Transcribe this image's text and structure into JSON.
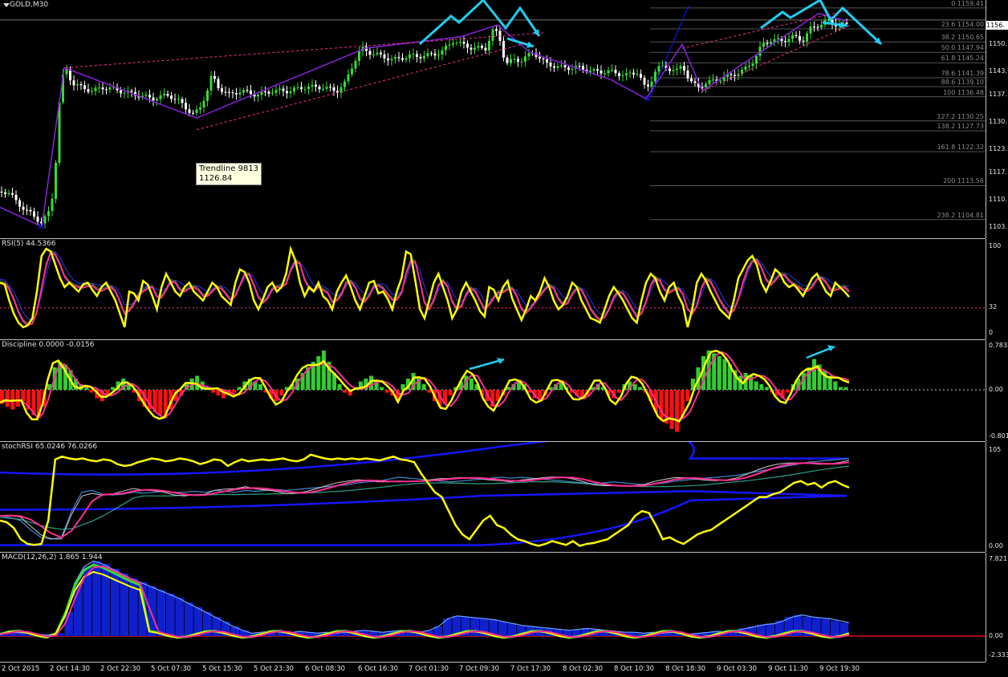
{
  "chart_data": [
    {
      "type": "candlestick",
      "title": "GOLD,M30",
      "price_ticks": [
        "1150.",
        "1143.",
        "1137.",
        "1130.",
        "1123.",
        "1117.",
        "1110.",
        "1103."
      ],
      "current_price": "1156.",
      "close_path": [
        [
          0,
          1112
        ],
        [
          10,
          1112
        ],
        [
          22,
          1109
        ],
        [
          40,
          1106
        ],
        [
          52,
          1104
        ],
        [
          62,
          1107
        ],
        [
          68,
          1114
        ],
        [
          72,
          1130
        ],
        [
          76,
          1140
        ],
        [
          82,
          1144
        ],
        [
          90,
          1140
        ],
        [
          100,
          1139
        ],
        [
          115,
          1138
        ],
        [
          130,
          1139
        ],
        [
          150,
          1138
        ],
        [
          170,
          1137
        ],
        [
          190,
          1136
        ],
        [
          210,
          1137
        ],
        [
          225,
          1135
        ],
        [
          240,
          1132
        ],
        [
          248,
          1133
        ],
        [
          258,
          1138
        ],
        [
          264,
          1142
        ],
        [
          272,
          1139
        ],
        [
          285,
          1137
        ],
        [
          300,
          1138
        ],
        [
          320,
          1137
        ],
        [
          340,
          1138
        ],
        [
          360,
          1138
        ],
        [
          380,
          1139
        ],
        [
          400,
          1139
        ],
        [
          420,
          1138
        ],
        [
          430,
          1140
        ],
        [
          440,
          1145
        ],
        [
          450,
          1149
        ],
        [
          460,
          1148
        ],
        [
          475,
          1147
        ],
        [
          490,
          1146
        ],
        [
          510,
          1147
        ],
        [
          530,
          1147
        ],
        [
          550,
          1148
        ],
        [
          565,
          1151
        ],
        [
          575,
          1150
        ],
        [
          590,
          1149
        ],
        [
          605,
          1149
        ],
        [
          615,
          1154
        ],
        [
          622,
          1152
        ],
        [
          630,
          1145
        ],
        [
          640,
          1146
        ],
        [
          650,
          1146
        ],
        [
          665,
          1148
        ],
        [
          680,
          1145
        ],
        [
          700,
          1144
        ],
        [
          720,
          1144
        ],
        [
          740,
          1143
        ],
        [
          760,
          1143
        ],
        [
          780,
          1142
        ],
        [
          795,
          1143
        ],
        [
          805,
          1138
        ],
        [
          812,
          1141
        ],
        [
          818,
          1144
        ],
        [
          830,
          1144
        ],
        [
          845,
          1143
        ],
        [
          850,
          1145
        ],
        [
          856,
          1142
        ],
        [
          862,
          1140
        ],
        [
          870,
          1139
        ],
        [
          880,
          1140
        ],
        [
          895,
          1141
        ],
        [
          910,
          1142
        ],
        [
          925,
          1143
        ],
        [
          940,
          1146
        ],
        [
          950,
          1150
        ],
        [
          960,
          1151
        ],
        [
          975,
          1151
        ],
        [
          990,
          1152
        ],
        [
          1000,
          1151
        ],
        [
          1010,
          1154
        ],
        [
          1020,
          1155
        ],
        [
          1030,
          1156
        ],
        [
          1045,
          1155
        ],
        [
          1055,
          1155
        ]
      ],
      "fibonacci": [
        {
          "level": "0",
          "price": "1159.41"
        },
        {
          "level": "23.6",
          "price": "1154.00"
        },
        {
          "level": "38.2",
          "price": "1150.65"
        },
        {
          "level": "50.0",
          "price": "1147.94"
        },
        {
          "level": "61.8",
          "price": "1145.24"
        },
        {
          "level": "78.6",
          "price": "1141.39"
        },
        {
          "level": "88.6",
          "price": "1139.10"
        },
        {
          "level": "100",
          "price": "1136.48"
        },
        {
          "level": "127.2",
          "price": "1130.25"
        },
        {
          "level": "138.2",
          "price": "1127.73"
        },
        {
          "level": "161.8",
          "price": "1122.32"
        },
        {
          "level": "200",
          "price": "1113.56"
        },
        {
          "level": "238.2",
          "price": "1104.81"
        }
      ],
      "tooltip": {
        "line1": "Trendline 9813",
        "line2": "1126.84"
      }
    },
    {
      "type": "line",
      "title": "RSI(5) 44.5366",
      "y_ticks": [
        "100",
        "32",
        "0"
      ],
      "ylim": [
        0,
        100
      ],
      "level": 32,
      "series": [
        {
          "values": [
            60,
            58,
            40,
            25,
            15,
            10,
            12,
            20,
            50,
            90,
            98,
            95,
            80,
            65,
            55,
            60,
            55,
            50,
            58,
            60,
            52,
            45,
            55,
            60,
            50,
            40,
            25,
            10,
            50,
            48,
            40,
            62,
            58,
            45,
            30,
            55,
            70,
            60,
            50,
            45,
            55,
            60,
            50,
            45,
            40,
            50,
            60,
            55,
            45,
            40,
            35,
            60,
            75,
            72,
            60,
            40,
            30,
            42,
            55,
            60,
            50,
            55,
            70,
            98,
            85,
            60,
            45,
            55,
            50,
            60,
            45,
            40,
            30,
            50,
            60,
            68,
            55,
            40,
            30,
            45,
            60,
            62,
            48,
            50,
            42,
            30,
            50,
            65,
            95,
            92,
            62,
            30,
            20,
            40,
            60,
            70,
            55,
            40,
            20,
            30,
            50,
            60,
            50,
            40,
            28,
            22,
            55,
            52,
            40,
            55,
            62,
            42,
            30,
            18,
            30,
            45,
            40,
            50,
            65,
            55,
            40,
            30,
            35,
            45,
            60,
            55,
            40,
            30,
            20,
            18,
            15,
            30,
            45,
            55,
            48,
            40,
            30,
            20,
            15,
            40,
            60,
            70,
            65,
            50,
            40,
            55,
            60,
            45,
            35,
            10,
            30,
            60,
            70,
            62,
            50,
            40,
            30,
            25,
            20,
            40,
            65,
            75,
            85,
            90,
            80,
            60,
            50,
            62,
            75,
            70,
            60,
            55,
            58,
            52,
            45,
            55,
            65,
            70,
            60,
            50,
            45,
            60,
            55,
            50,
            44
          ]
        }
      ]
    },
    {
      "type": "bar",
      "title": "Discipline 0.0000 -0.0156",
      "y_ticks": [
        "0.7832",
        "0.00",
        "-0.801"
      ],
      "ylim": [
        -0.801,
        0.7832
      ],
      "values": [
        -0.25,
        -0.3,
        -0.35,
        -0.3,
        -0.2,
        -0.35,
        -0.45,
        -0.5,
        -0.3,
        0.1,
        0.4,
        0.5,
        0.45,
        0.35,
        0.2,
        0.1,
        0.05,
        -0.05,
        -0.15,
        -0.2,
        -0.1,
        0.05,
        0.15,
        0.2,
        0.1,
        -0.05,
        -0.2,
        -0.3,
        -0.35,
        -0.4,
        -0.45,
        -0.5,
        -0.35,
        -0.2,
        -0.1,
        0.1,
        0.2,
        0.25,
        0.15,
        0.05,
        -0.05,
        -0.1,
        -0.15,
        -0.1,
        -0.05,
        0.05,
        0.15,
        0.2,
        0.15,
        0.1,
        -0.05,
        -0.15,
        -0.2,
        -0.1,
        0.05,
        0.1,
        0.2,
        0.3,
        0.4,
        0.5,
        0.6,
        0.7,
        0.5,
        0.3,
        0.1,
        -0.05,
        -0.1,
        0.05,
        0.15,
        0.2,
        0.25,
        0.15,
        0.05,
        -0.05,
        -0.1,
        -0.2,
        0.1,
        0.2,
        0.3,
        0.2,
        0.1,
        -0.05,
        -0.2,
        -0.3,
        -0.25,
        -0.1,
        0.05,
        0.15,
        0.25,
        0.2,
        0.1,
        -0.1,
        -0.2,
        -0.3,
        -0.2,
        -0.1,
        0.05,
        0.1,
        0.15,
        0.1,
        -0.05,
        -0.15,
        -0.2,
        -0.1,
        0.05,
        0.1,
        0.15,
        0.05,
        -0.05,
        -0.1,
        -0.15,
        -0.1,
        0.05,
        0.1,
        0.05,
        -0.1,
        -0.15,
        -0.05,
        0.1,
        0.15,
        0.1,
        0.05,
        -0.05,
        -0.2,
        -0.4,
        -0.55,
        -0.6,
        -0.7,
        -0.75,
        -0.5,
        -0.2,
        0.2,
        0.4,
        0.6,
        0.7,
        0.65,
        0.6,
        0.55,
        0.45,
        0.35,
        0.25,
        0.3,
        0.25,
        0.15,
        0.1,
        0.05,
        -0.05,
        -0.1,
        -0.15,
        -0.05,
        0.1,
        0.2,
        0.3,
        0.4,
        0.55,
        0.45,
        0.35,
        0.25,
        0.15,
        0.05,
        0.05
      ]
    },
    {
      "type": "line",
      "title": "stochRSI 65.0246 76.0266",
      "y_ticks": [
        "105",
        "0.00"
      ],
      "ylim": [
        0,
        105
      ],
      "series": [
        {
          "values": [
            30,
            28,
            22,
            10,
            5,
            4,
            5,
            30,
            95,
            98,
            96,
            95,
            96,
            94,
            93,
            95,
            94,
            90,
            88,
            89,
            92,
            94,
            96,
            95,
            93,
            94,
            96,
            95,
            93,
            90,
            92,
            95,
            94,
            88,
            92,
            95,
            93,
            94,
            95,
            94,
            95,
            96,
            94,
            93,
            95,
            100,
            98,
            96,
            95,
            96,
            95,
            96,
            95,
            96,
            95,
            94,
            96,
            98,
            95,
            94,
            92,
            80,
            70,
            60,
            55,
            40,
            25,
            15,
            10,
            20,
            30,
            35,
            25,
            22,
            15,
            10,
            8,
            5,
            3,
            5,
            8,
            6,
            4,
            8,
            3,
            5,
            6,
            8,
            10,
            15,
            20,
            25,
            35,
            40,
            38,
            25,
            10,
            12,
            8,
            5,
            10,
            15,
            18,
            20,
            25,
            30,
            35,
            40,
            45,
            50,
            55,
            55,
            58,
            60,
            65,
            70,
            72,
            68,
            70,
            65,
            70,
            72,
            68,
            65
          ]
        },
        {
          "values": [
            35,
            33,
            30,
            20,
            12,
            10,
            12,
            40,
            60,
            62,
            58,
            57,
            58,
            60,
            59,
            60,
            61,
            60,
            60,
            61,
            60,
            62,
            61,
            60,
            62,
            61,
            62,
            63,
            62,
            63,
            64,
            65,
            66,
            67,
            68,
            70,
            71,
            72,
            74,
            76,
            75,
            74,
            73,
            72,
            71,
            72,
            73,
            74,
            75,
            76,
            75,
            76,
            75,
            74,
            73,
            72,
            71,
            70,
            69,
            70,
            71,
            70,
            69,
            68,
            69,
            70,
            72,
            73,
            74,
            75,
            76,
            77,
            78,
            80,
            82,
            84,
            86,
            88,
            90,
            92,
            93,
            94,
            95,
            96
          ]
        }
      ]
    },
    {
      "type": "area",
      "title": "MACD(12,26,2) 1.865 1.944",
      "y_ticks": [
        "7.821",
        "0.00",
        "-2.333"
      ],
      "ylim": [
        -2.333,
        7.821
      ],
      "values": [
        0.3,
        0.4,
        0.35,
        0.3,
        0.2,
        0.1,
        0.3,
        2.5,
        5.5,
        7.2,
        7.8,
        7.5,
        7.0,
        6.5,
        6.0,
        5.6,
        5.2,
        4.8,
        4.4,
        4.0,
        3.5,
        3.0,
        2.5,
        2.0,
        1.5,
        1.0,
        0.6,
        0.3,
        0.4,
        0.5,
        0.4,
        0.3,
        0.5,
        0.4,
        0.3,
        0.4,
        0.3,
        0.4,
        0.5,
        0.6,
        0.5,
        0.4,
        0.5,
        0.6,
        0.5,
        0.4,
        0.6,
        1.0,
        1.8,
        2.1,
        2.0,
        1.9,
        1.8,
        1.7,
        1.5,
        1.3,
        1.1,
        1.0,
        0.9,
        0.8,
        0.7,
        0.6,
        0.7,
        0.8,
        0.7,
        0.6,
        0.5,
        0.4,
        0.4,
        0.3,
        0.4,
        0.3,
        0.4,
        0.3,
        0.2,
        0.3,
        0.4,
        0.5,
        0.4,
        0.6,
        0.8,
        1.0,
        1.2,
        1.3,
        1.6,
        2.0,
        2.2,
        2.0,
        1.9,
        1.8,
        1.6,
        1.4
      ]
    }
  ],
  "x_labels": [
    "2 Oct 2015",
    "2 Oct 14:30",
    "2 Oct 22:30",
    "5 Oct 07:30",
    "5 Oct 15:30",
    "5 Oct 23:30",
    "6 Oct 08:30",
    "6 Oct 16:30",
    "7 Oct 01:30",
    "7 Oct 09:30",
    "7 Oct 17:30",
    "8 Oct 02:30",
    "8 Oct 10:30",
    "8 Oct 18:30",
    "9 Oct 03:30",
    "9 Oct 11:30",
    "9 Oct 19:30"
  ],
  "colors": {
    "bull": "#33dd33",
    "bear": "#ffffff",
    "yellow": "#ffff00",
    "magenta": "#ff2e93",
    "blue": "#1515ff",
    "cyan": "#22ccee",
    "purple": "#8022cc",
    "bear_hist": "#ff1010",
    "bull_hist": "#33cc33"
  }
}
